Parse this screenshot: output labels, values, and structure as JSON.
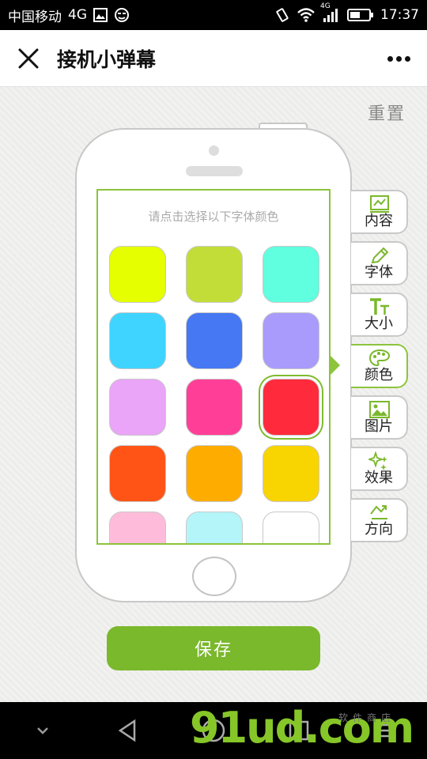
{
  "status_bar": {
    "carrier": "中国移动",
    "network": "4G",
    "signal_badge": "4G",
    "time": "17:37"
  },
  "title_bar": {
    "title": "接机小弹幕"
  },
  "main": {
    "reset_label": "重置",
    "hint": "请点击选择以下字体颜色",
    "save_label": "保存"
  },
  "color_swatches": [
    {
      "color": "#e5ff00"
    },
    {
      "color": "#c3dd38"
    },
    {
      "color": "#5fffe0"
    },
    {
      "color": "#3fd4ff"
    },
    {
      "color": "#4578f2"
    },
    {
      "color": "#a89bfb"
    },
    {
      "color": "#eaa4f8"
    },
    {
      "color": "#ff3f97"
    },
    {
      "color": "#ff2a3c",
      "selected": true
    },
    {
      "color": "#ff5416"
    },
    {
      "color": "#ffac00"
    },
    {
      "color": "#f8d400"
    },
    {
      "color": "#ffbcda"
    },
    {
      "color": "#b4f5f9"
    },
    {
      "color": "#ffffff"
    }
  ],
  "side_tabs": [
    {
      "label": "内容",
      "icon": "content-icon"
    },
    {
      "label": "字体",
      "icon": "pencil-icon"
    },
    {
      "label": "大小",
      "icon": "font-size-icon"
    },
    {
      "label": "颜色",
      "icon": "palette-icon",
      "active": true
    },
    {
      "label": "图片",
      "icon": "image-icon"
    },
    {
      "label": "效果",
      "icon": "sparkle-icon"
    },
    {
      "label": "方向",
      "icon": "direction-icon"
    }
  ],
  "watermark": {
    "text": "91ud.com",
    "sub_text": "软件商店"
  },
  "colors": {
    "accent_green": "#7ab82c",
    "border_green": "#8cc43c"
  }
}
